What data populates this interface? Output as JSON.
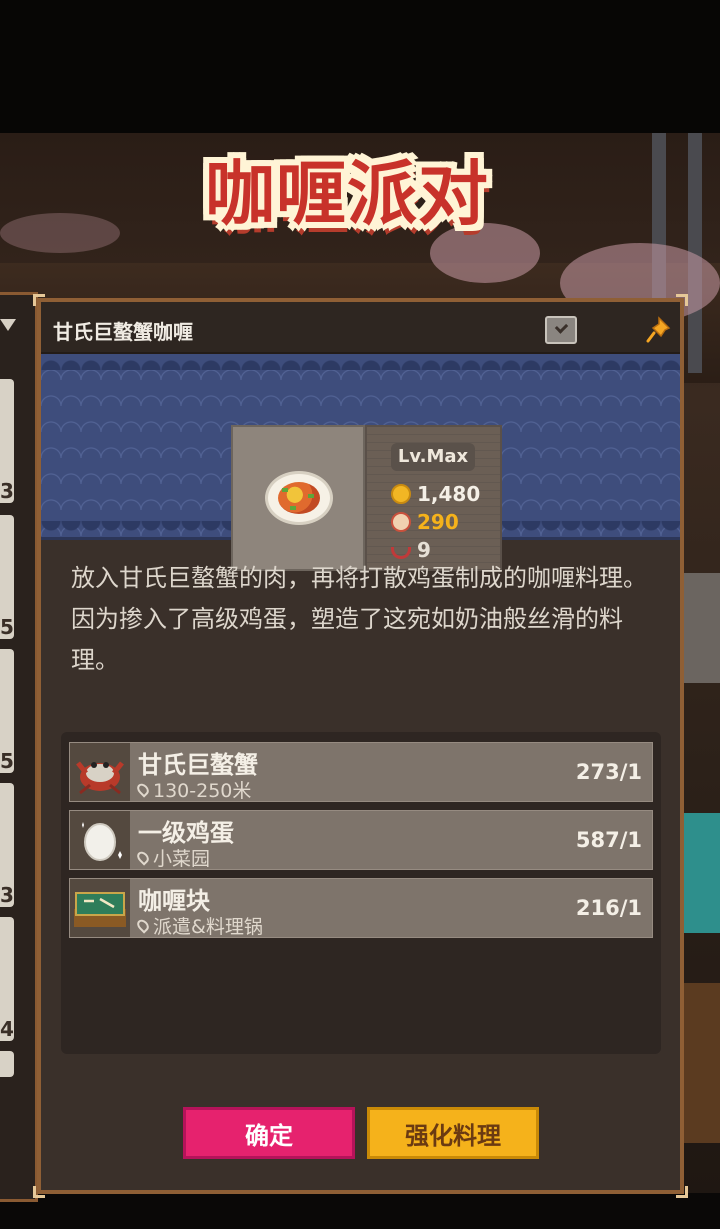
{
  "title_banner": "咖喱派对",
  "panel": {
    "title": "甘氏巨螯蟹咖喱",
    "checkbox_icon": "checkbox-icon",
    "pin_icon": "pin-icon"
  },
  "dish": {
    "level": "Lv.Max",
    "coins": "1,480",
    "cookies": "290",
    "bowls": "9"
  },
  "description": [
    "放入甘氏巨螯蟹的肉，再将打散鸡蛋制成的咖喱料理。",
    "因为掺入了高级鸡蛋，塑造了这宛如奶油般丝滑的料理。"
  ],
  "ingredients": [
    {
      "name": "甘氏巨螯蟹",
      "location": "130-250米",
      "count": "273/1",
      "icon": "crab-icon"
    },
    {
      "name": "一级鸡蛋",
      "location": "小菜园",
      "count": "587/1",
      "icon": "egg-icon"
    },
    {
      "name": "咖喱块",
      "location": "派遣&料理锅",
      "count": "216/1",
      "icon": "curry-block-icon"
    }
  ],
  "buttons": {
    "confirm": "确定",
    "upgrade": "强化料理"
  },
  "side_tabs": [
    "3",
    "5",
    "5",
    "3",
    "4"
  ],
  "colors": {
    "confirm": "#e6226e",
    "upgrade": "#f5b21b",
    "frame": "#8f5f35",
    "hero_bg": "#3e4d7c"
  }
}
